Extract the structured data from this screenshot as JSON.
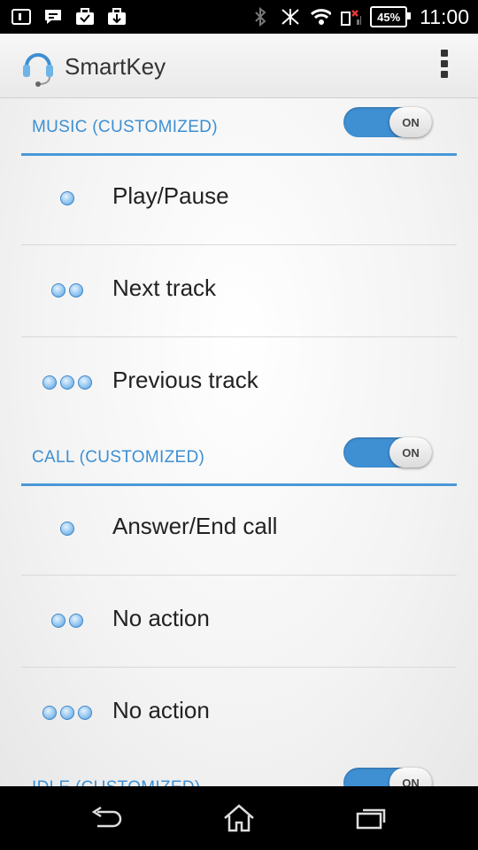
{
  "status_bar": {
    "battery": "45%",
    "time": "11:00"
  },
  "app": {
    "title": "SmartKey"
  },
  "sections": [
    {
      "title": "MUSIC (CUSTOMIZED)",
      "toggle": "ON",
      "rows": [
        {
          "presses": 1,
          "label": "Play/Pause"
        },
        {
          "presses": 2,
          "label": "Next track"
        },
        {
          "presses": 3,
          "label": "Previous track"
        }
      ]
    },
    {
      "title": "CALL (CUSTOMIZED)",
      "toggle": "ON",
      "rows": [
        {
          "presses": 1,
          "label": "Answer/End call"
        },
        {
          "presses": 2,
          "label": "No action"
        },
        {
          "presses": 3,
          "label": "No action"
        }
      ]
    },
    {
      "title": "IDLE (CUSTOMIZED)",
      "toggle": "ON",
      "rows": []
    }
  ],
  "nav": [
    "back-icon",
    "home-icon",
    "recents-icon"
  ],
  "colors": {
    "accent": "#3d8fd2",
    "toggle_on": "#3f8fd3"
  }
}
